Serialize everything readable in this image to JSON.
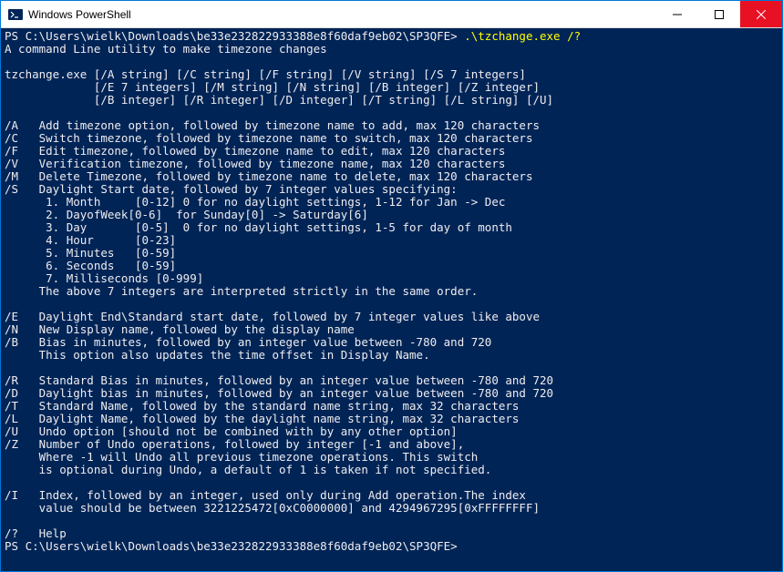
{
  "window": {
    "title": "Windows PowerShell"
  },
  "terminal": {
    "prompt1_path": "PS C:\\Users\\wielk\\Downloads\\be33e232822933388e8f60daf9eb02\\SP3QFE> ",
    "prompt1_cmd": ".\\tzchange.exe /?",
    "output": [
      "A command Line utility to make timezone changes",
      "",
      "tzchange.exe [/A string] [/C string] [/F string] [/V string] [/S 7 integers]",
      "             [/E 7 integers] [/M string] [/N string] [/B integer] [/Z integer]",
      "             [/B integer] [/R integer] [/D integer] [/T string] [/L string] [/U]",
      "",
      "/A   Add timezone option, followed by timezone name to add, max 120 characters",
      "/C   Switch timezone, followed by timezone name to switch, max 120 characters",
      "/F   Edit timezone, followed by timezone name to edit, max 120 characters",
      "/V   Verification timezone, followed by timezone name, max 120 characters",
      "/M   Delete Timezone, followed by timezone name to delete, max 120 characters",
      "/S   Daylight Start date, followed by 7 integer values specifying:",
      "      1. Month     [0-12] 0 for no daylight settings, 1-12 for Jan -> Dec",
      "      2. DayofWeek[0-6]  for Sunday[0] -> Saturday[6]",
      "      3. Day       [0-5]  0 for no daylight settings, 1-5 for day of month",
      "      4. Hour      [0-23]",
      "      5. Minutes   [0-59]",
      "      6. Seconds   [0-59]",
      "      7. Milliseconds [0-999]",
      "     The above 7 integers are interpreted strictly in the same order.",
      "",
      "/E   Daylight End\\Standard start date, followed by 7 integer values like above",
      "/N   New Display name, followed by the display name",
      "/B   Bias in minutes, followed by an integer value between -780 and 720",
      "     This option also updates the time offset in Display Name.",
      "",
      "/R   Standard Bias in minutes, followed by an integer value between -780 and 720",
      "/D   Daylight bias in minutes, followed by an integer value between -780 and 720",
      "/T   Standard Name, followed by the standard name string, max 32 characters",
      "/L   Daylight Name, followed by the daylight name string, max 32 characters",
      "/U   Undo option [should not be combined with by any other option]",
      "/Z   Number of Undo operations, followed by integer [-1 and above],",
      "     Where -1 will Undo all previous timezone operations. This switch",
      "     is optional during Undo, a default of 1 is taken if not specified.",
      "",
      "/I   Index, followed by an integer, used only during Add operation.The index",
      "     value should be between 3221225472[0xC0000000] and 4294967295[0xFFFFFFFF]",
      "",
      "/?   Help"
    ],
    "prompt2_path": "PS C:\\Users\\wielk\\Downloads\\be33e232822933388e8f60daf9eb02\\SP3QFE> ",
    "prompt2_cmd": ""
  }
}
